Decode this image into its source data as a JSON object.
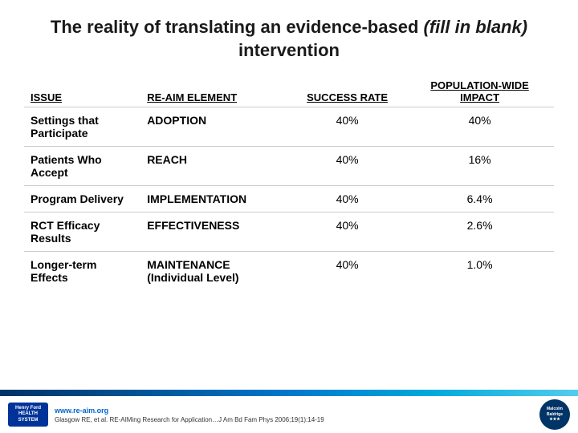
{
  "title": {
    "line1": "The reality of translating an evidence-based ",
    "italic": "(fill in blank)",
    "line2": "intervention"
  },
  "table": {
    "headers": {
      "issue": "ISSUE",
      "reaim": "RE-AIM ELEMENT",
      "success": "SUCCESS RATE",
      "population": "POPULATION-WIDE IMPACT"
    },
    "rows": [
      {
        "issue": "Settings that Participate",
        "reaim": "ADOPTION",
        "success": "40%",
        "population": "40%"
      },
      {
        "issue": "Patients Who Accept",
        "reaim": "REACH",
        "success": "40%",
        "population": "16%"
      },
      {
        "issue": "Program Delivery",
        "reaim": "IMPLEMENTATION",
        "success": "40%",
        "population": "6.4%"
      },
      {
        "issue": "RCT Efficacy Results",
        "reaim": "EFFECTIVENESS",
        "success": "40%",
        "population": "2.6%"
      },
      {
        "issue": "Longer-term Effects",
        "reaim": "MAINTENANCE (Individual Level)",
        "success": "40%",
        "population": "1.0%"
      }
    ]
  },
  "footer": {
    "link": "www.re-aim.org",
    "citation": "Glasgow RE, et al. RE-AIMing Research for Application…J Am Bd Fam Phys 2006;19(1):14-19",
    "logo_text": "Henry Ford\nHEALTH SYSTEM",
    "mb_text": "Malcolm\nBaldrige"
  }
}
